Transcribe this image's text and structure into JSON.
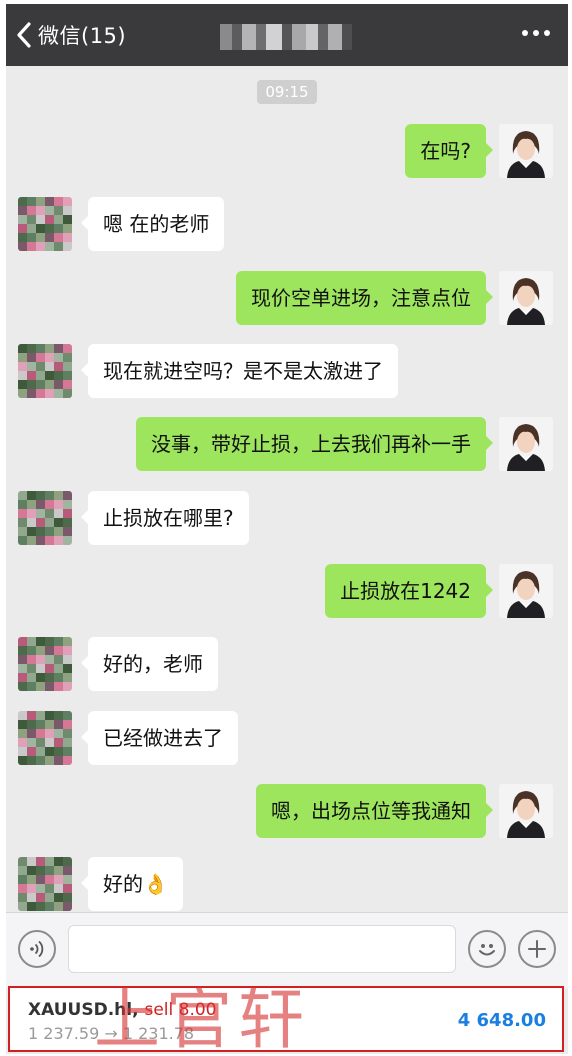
{
  "header": {
    "back_label": "微信(15)",
    "title_blurred": true
  },
  "timestamp": "09:15",
  "messages": [
    {
      "side": "out",
      "text": "在吗?"
    },
    {
      "side": "in",
      "text": "嗯 在的老师"
    },
    {
      "side": "out",
      "text": "现价空单进场，注意点位"
    },
    {
      "side": "in",
      "text": "现在就进空吗？是不是太激进了"
    },
    {
      "side": "out",
      "text": "没事，带好止损，上去我们再补一手"
    },
    {
      "side": "in",
      "text": "止损放在哪里?"
    },
    {
      "side": "out",
      "text": "止损放在1242"
    },
    {
      "side": "in",
      "text": "好的，老师"
    },
    {
      "side": "in",
      "text": "已经做进去了"
    },
    {
      "side": "out",
      "text": "嗯，出场点位等我通知"
    },
    {
      "side": "in",
      "text": "好的👌"
    }
  ],
  "input": {
    "value": "",
    "voice_icon": "voice-icon",
    "emoji_icon": "emoji-icon",
    "add_icon": "plus-icon"
  },
  "ticker": {
    "symbol": "XAUUSD.hl,",
    "side_lot": "sell 8.00",
    "prices": "1 237.59 → 1 231.78",
    "profit": "4 648.00",
    "watermark": "上官轩"
  },
  "colors": {
    "header_bg": "#3a3a3c",
    "chat_bg": "#ebebeb",
    "bubble_out": "#9de55d",
    "bubble_in": "#ffffff",
    "sell_red": "#d21f1f",
    "profit_blue": "#1a7fe0"
  }
}
